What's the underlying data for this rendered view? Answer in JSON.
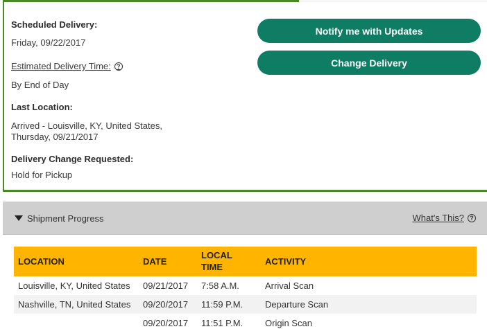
{
  "delivery": {
    "scheduled_label": "Scheduled Delivery:",
    "scheduled_value": "Friday, 09/22/2017",
    "estimated_label": "Estimated Delivery Time:",
    "estimated_value": "By End of Day",
    "last_location_label": "Last Location:",
    "last_location_line1": "Arrived - Louisville, KY, United States,",
    "last_location_line2": "Thursday, 09/21/2017",
    "change_label": "Delivery Change Requested:",
    "change_value": "Hold for Pickup"
  },
  "buttons": {
    "notify": "Notify me with Updates",
    "change": "Change Delivery"
  },
  "progress": {
    "title": "Shipment Progress",
    "whats_this": "What's This?",
    "help_glyph": "?",
    "columns": {
      "location": "LOCATION",
      "date": "DATE",
      "local_time_1": "LOCAL",
      "local_time_2": "TIME",
      "activity": "ACTIVITY"
    },
    "rows": [
      {
        "location": "Louisville,  KY,  United States",
        "date": "09/21/2017",
        "time": "7:58 A.M.",
        "activity": "Arrival Scan"
      },
      {
        "location": "Nashville,  TN,  United States",
        "date": "09/20/2017",
        "time": "11:59 P.M.",
        "activity": "Departure Scan"
      },
      {
        "location": "",
        "date": "09/20/2017",
        "time": "11:51 P.M.",
        "activity": "Origin Scan"
      }
    ]
  },
  "colors": {
    "accent_green": "#4a8a26",
    "button_teal": "#0f7d63",
    "table_header": "#ffb500"
  }
}
